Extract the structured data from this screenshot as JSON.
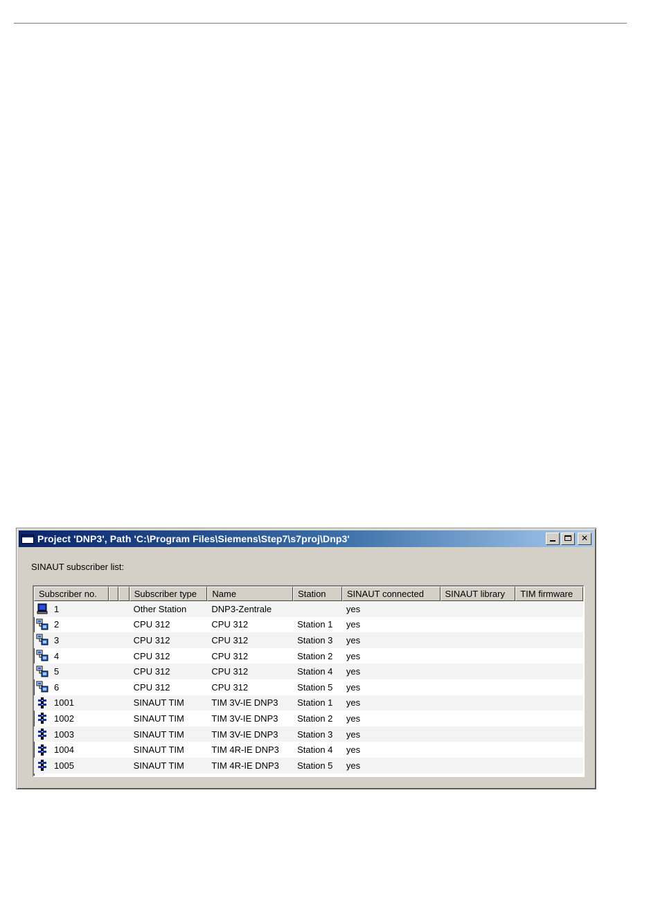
{
  "window": {
    "title": "Project 'DNP3', Path 'C:\\Program Files\\Siemens\\Step7\\s7proj\\Dnp3'",
    "controls": {
      "minimize": "_",
      "maximize": "□",
      "close": "✕"
    }
  },
  "list_label": "SINAUT subscriber list:",
  "columns": [
    "Subscriber no.",
    "",
    "",
    "Subscriber type",
    "Name",
    "Station",
    "SINAUT connected",
    "SINAUT library",
    "TIM firmware"
  ],
  "rows": [
    {
      "icon": "monitor-station-icon",
      "no": "1",
      "type": "Other Station",
      "name": "DNP3-Zentrale",
      "station": "",
      "connected": "yes",
      "library": "",
      "firmware": ""
    },
    {
      "icon": "cpu-station-icon",
      "no": "2",
      "type": "CPU 312",
      "name": "CPU 312",
      "station": "Station 1",
      "connected": "yes",
      "library": "",
      "firmware": ""
    },
    {
      "icon": "cpu-station-icon",
      "no": "3",
      "type": "CPU 312",
      "name": "CPU 312",
      "station": "Station 3",
      "connected": "yes",
      "library": "",
      "firmware": ""
    },
    {
      "icon": "cpu-station-icon",
      "no": "4",
      "type": "CPU 312",
      "name": "CPU 312",
      "station": "Station 2",
      "connected": "yes",
      "library": "",
      "firmware": ""
    },
    {
      "icon": "cpu-station-icon",
      "no": "5",
      "type": "CPU 312",
      "name": "CPU 312",
      "station": "Station 4",
      "connected": "yes",
      "library": "",
      "firmware": ""
    },
    {
      "icon": "cpu-station-icon",
      "no": "6",
      "type": "CPU 312",
      "name": "CPU 312",
      "station": "Station 5",
      "connected": "yes",
      "library": "",
      "firmware": ""
    },
    {
      "icon": "tim-module-icon",
      "no": "1001",
      "type": "SINAUT TIM",
      "name": "TIM 3V-IE DNP3",
      "station": "Station 1",
      "connected": "yes",
      "library": "",
      "firmware": ""
    },
    {
      "icon": "tim-module-icon",
      "no": "1002",
      "type": "SINAUT TIM",
      "name": "TIM 3V-IE DNP3",
      "station": "Station 2",
      "connected": "yes",
      "library": "",
      "firmware": ""
    },
    {
      "icon": "tim-module-icon",
      "no": "1003",
      "type": "SINAUT TIM",
      "name": "TIM 3V-IE DNP3",
      "station": "Station 3",
      "connected": "yes",
      "library": "",
      "firmware": ""
    },
    {
      "icon": "tim-module-icon",
      "no": "1004",
      "type": "SINAUT TIM",
      "name": "TIM 4R-IE DNP3",
      "station": "Station 4",
      "connected": "yes",
      "library": "",
      "firmware": ""
    },
    {
      "icon": "tim-module-icon",
      "no": "1005",
      "type": "SINAUT TIM",
      "name": "TIM 4R-IE DNP3",
      "station": "Station 5",
      "connected": "yes",
      "library": "",
      "firmware": ""
    }
  ],
  "colors": {
    "titlebar_start": "#0a246a",
    "titlebar_end": "#a6caf0",
    "window_bg": "#d4d0c8"
  }
}
